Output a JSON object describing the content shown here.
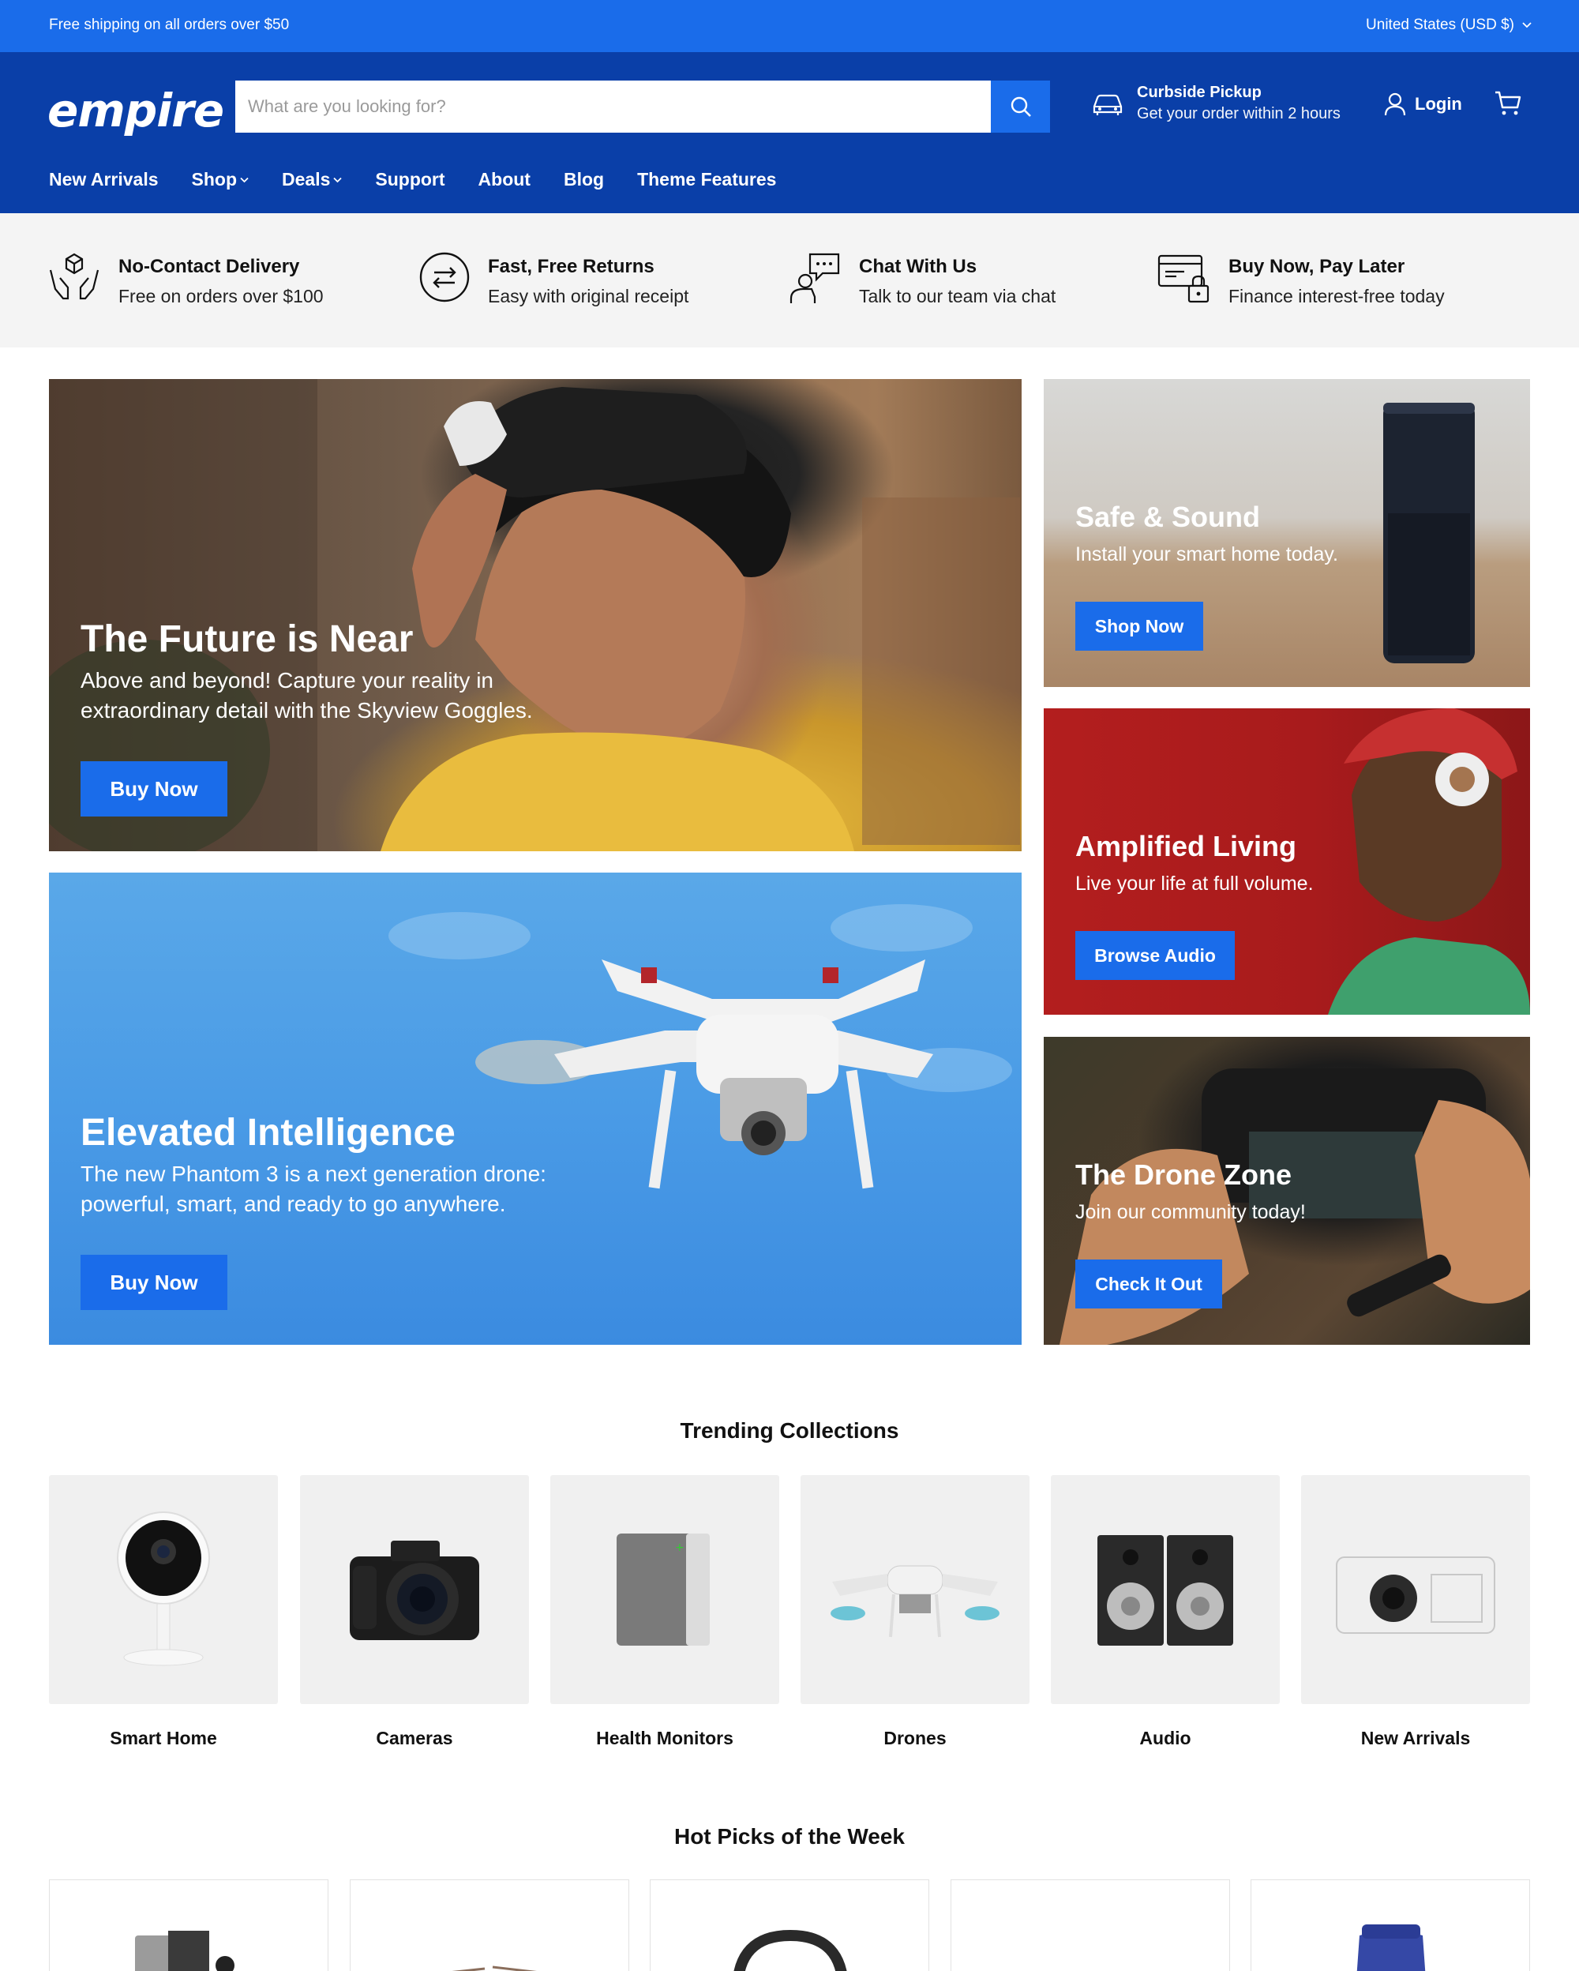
{
  "announcement": {
    "left_text": "Free shipping on all orders over $50",
    "currency": "United States (USD $)"
  },
  "header": {
    "logo": "empire",
    "search_placeholder": "What are you looking for?",
    "pickup_title": "Curbside Pickup",
    "pickup_sub": "Get your order within 2 hours",
    "login": "Login"
  },
  "nav": [
    {
      "label": "New Arrivals",
      "dropdown": false
    },
    {
      "label": "Shop",
      "dropdown": true
    },
    {
      "label": "Deals",
      "dropdown": true
    },
    {
      "label": "Support",
      "dropdown": false
    },
    {
      "label": "About",
      "dropdown": false
    },
    {
      "label": "Blog",
      "dropdown": false
    },
    {
      "label": "Theme Features",
      "dropdown": false
    }
  ],
  "features": [
    {
      "title": "No-Contact Delivery",
      "sub": "Free on orders over $100",
      "icon": "hands-box-icon"
    },
    {
      "title": "Fast, Free Returns",
      "sub": "Easy with original receipt",
      "icon": "exchange-arrows-icon"
    },
    {
      "title": "Chat With Us",
      "sub": "Talk to our team via chat",
      "icon": "chat-person-icon"
    },
    {
      "title": "Buy Now, Pay Later",
      "sub": "Finance interest-free today",
      "icon": "card-lock-icon"
    }
  ],
  "banners": {
    "future": {
      "title": "The Future is Near",
      "sub1": "Above and beyond! Capture your reality in",
      "sub2": "extraordinary detail with the Skyview Goggles.",
      "button": "Buy Now"
    },
    "drone": {
      "title": "Elevated Intelligence",
      "sub1": "The new Phantom 3 is a next generation drone:",
      "sub2": "powerful, smart, and ready to go anywhere.",
      "button": "Buy Now"
    },
    "safe": {
      "title": "Safe & Sound",
      "sub": "Install your smart home today.",
      "button": "Shop Now"
    },
    "audio": {
      "title": "Amplified Living",
      "sub": "Live your life at full volume.",
      "button": "Browse Audio"
    },
    "dronezone": {
      "title": "The Drone Zone",
      "sub": "Join our community today!",
      "button": "Check It Out"
    }
  },
  "trending": {
    "title": "Trending Collections",
    "items": [
      "Smart Home",
      "Cameras",
      "Health Monitors",
      "Drones",
      "Audio",
      "New Arrivals"
    ]
  },
  "hot_picks": {
    "title": "Hot Picks of the Week"
  },
  "colors": {
    "accent": "#1a6cea",
    "header": "#0a3fa8",
    "announce": "#1a6cea"
  }
}
